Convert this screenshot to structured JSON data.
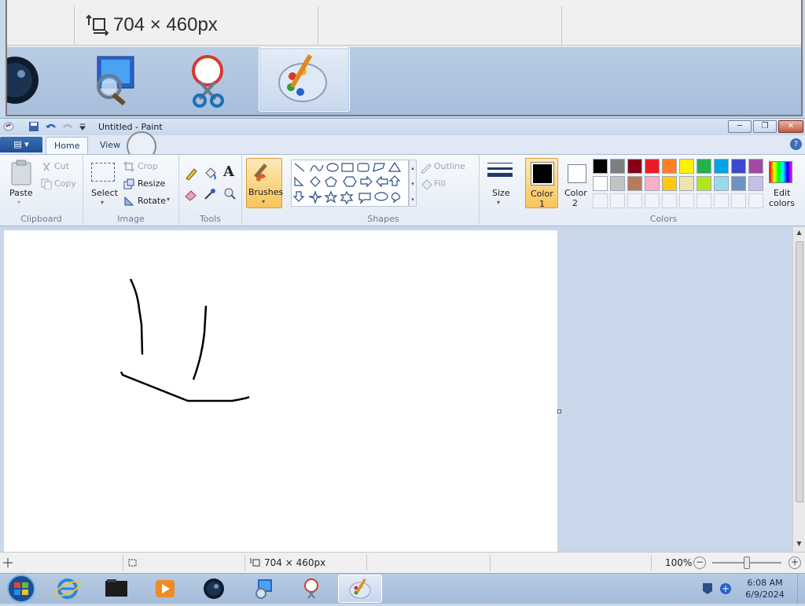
{
  "zoom": {
    "size_text": "704 × 460px"
  },
  "window": {
    "title": "Untitled - Paint",
    "minimize": "─",
    "restore": "❐",
    "close": "✕",
    "help": "?"
  },
  "tabs": {
    "file": "▤ ▾",
    "home": "Home",
    "view": "View"
  },
  "ribbon": {
    "clipboard": {
      "label": "Clipboard",
      "paste": "Paste",
      "cut": "Cut",
      "copy": "Copy"
    },
    "image": {
      "label": "Image",
      "select": "Select",
      "crop": "Crop",
      "resize": "Resize",
      "rotate": "Rotate"
    },
    "tools": {
      "label": "Tools",
      "text_glyph": "A"
    },
    "brushes": {
      "label": "Brushes"
    },
    "shapes": {
      "label": "Shapes",
      "outline": "Outline",
      "fill": "Fill"
    },
    "size": {
      "label": "Size"
    },
    "colors": {
      "label": "Colors",
      "color1": "Color",
      "color1_num": "1",
      "color2": "Color",
      "color2_num": "2",
      "edit": "Edit",
      "edit2": "colors",
      "row1": [
        "#000000",
        "#7f7f7f",
        "#880015",
        "#ed1c24",
        "#ff7f27",
        "#fff200",
        "#22b14c",
        "#00a2e8",
        "#3f48cc",
        "#a349a4"
      ],
      "row2": [
        "#ffffff",
        "#c3c3c3",
        "#b97a57",
        "#ffaec9",
        "#ffc90e",
        "#efe4b0",
        "#b5e61d",
        "#99d9ea",
        "#7092be",
        "#c8bfe7"
      ]
    }
  },
  "status": {
    "size_text": "704 × 460px",
    "zoom_text": "100%"
  },
  "taskbar": {
    "time": "6:08 AM",
    "date": "6/9/2024"
  }
}
